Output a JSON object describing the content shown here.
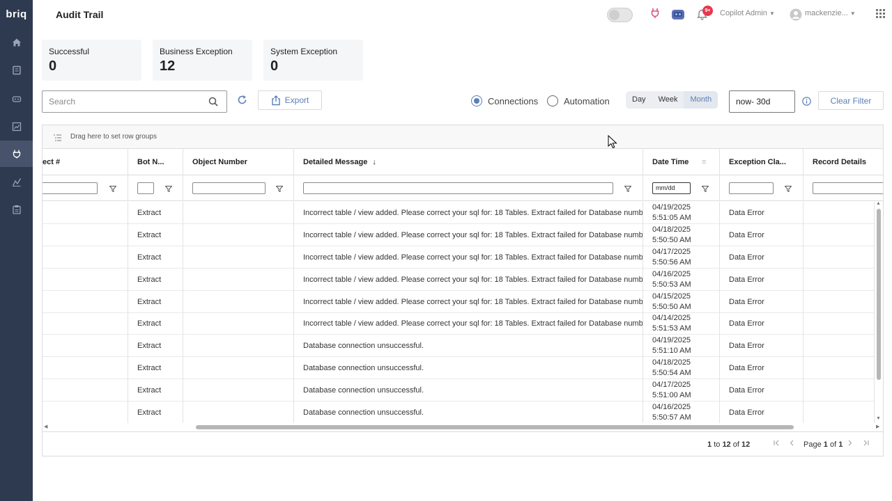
{
  "app": {
    "logo": "briq",
    "title": "Audit Trail"
  },
  "header": {
    "user_menu": "Copilot Admin",
    "username": "mackenzie...",
    "notif_badge": "9+"
  },
  "sidebar": {
    "items": [
      {
        "icon": "home-icon"
      },
      {
        "icon": "document-icon"
      },
      {
        "icon": "robot-icon"
      },
      {
        "icon": "chart-icon"
      },
      {
        "icon": "plug-icon",
        "active": true
      },
      {
        "icon": "analytics-icon"
      },
      {
        "icon": "clipboard-icon"
      }
    ]
  },
  "summary": {
    "successful": {
      "label": "Successful",
      "value": "0"
    },
    "business": {
      "label": "Business Exception",
      "value": "12"
    },
    "system": {
      "label": "System Exception",
      "value": "0"
    }
  },
  "toolbar": {
    "search_placeholder": "Search",
    "export_label": "Export",
    "radio_connections": "Connections",
    "radio_automation": "Automation",
    "seg_day": "Day",
    "seg_week": "Week",
    "seg_month": "Month",
    "range_value": "now- 30d",
    "clear_filter": "Clear Filter"
  },
  "grid": {
    "group_hint": "Drag here to set row groups",
    "columns": {
      "project": "ect #",
      "bot": "Bot N...",
      "object": "Object Number",
      "message": "Detailed Message",
      "datetime": "Date Time",
      "exception": "Exception Cla...",
      "record": "Record Details"
    },
    "date_filter": "mm/dd",
    "rows": [
      {
        "bot": "Extract",
        "message": "Incorrect table / view added. Please correct your sql for: 18 Tables. Extract failed for Database numb",
        "date": "04/19/2025",
        "time": "5:51:05 AM",
        "exception": "Data Error"
      },
      {
        "bot": "Extract",
        "message": "Incorrect table / view added. Please correct your sql for: 18 Tables. Extract failed for Database numb",
        "date": "04/18/2025",
        "time": "5:50:50 AM",
        "exception": "Data Error"
      },
      {
        "bot": "Extract",
        "message": "Incorrect table / view added. Please correct your sql for: 18 Tables. Extract failed for Database numb",
        "date": "04/17/2025",
        "time": "5:50:56 AM",
        "exception": "Data Error"
      },
      {
        "bot": "Extract",
        "message": "Incorrect table / view added. Please correct your sql for: 18 Tables. Extract failed for Database numb",
        "date": "04/16/2025",
        "time": "5:50:53 AM",
        "exception": "Data Error"
      },
      {
        "bot": "Extract",
        "message": "Incorrect table / view added. Please correct your sql for: 18 Tables. Extract failed for Database numb",
        "date": "04/15/2025",
        "time": "5:50:50 AM",
        "exception": "Data Error"
      },
      {
        "bot": "Extract",
        "message": "Incorrect table / view added. Please correct your sql for: 18 Tables. Extract failed for Database numb",
        "date": "04/14/2025",
        "time": "5:51:53 AM",
        "exception": "Data Error"
      },
      {
        "bot": "Extract",
        "message": "Database connection unsuccessful.",
        "date": "04/19/2025",
        "time": "5:51:10 AM",
        "exception": "Data Error"
      },
      {
        "bot": "Extract",
        "message": "Database connection unsuccessful.",
        "date": "04/18/2025",
        "time": "5:50:54 AM",
        "exception": "Data Error"
      },
      {
        "bot": "Extract",
        "message": "Database connection unsuccessful.",
        "date": "04/17/2025",
        "time": "5:51:00 AM",
        "exception": "Data Error"
      },
      {
        "bot": "Extract",
        "message": "Database connection unsuccessful.",
        "date": "04/16/2025",
        "time": "5:50:57 AM",
        "exception": "Data Error"
      }
    ]
  },
  "pager": {
    "from": "1",
    "to": "12",
    "total": "12",
    "page": "1",
    "pages": "1",
    "to_word": "to",
    "of_word": "of",
    "page_word": "Page"
  },
  "colors": {
    "accent": "#5b7fb8",
    "sidebar": "#2d3a4f",
    "badge": "#e8384f"
  }
}
